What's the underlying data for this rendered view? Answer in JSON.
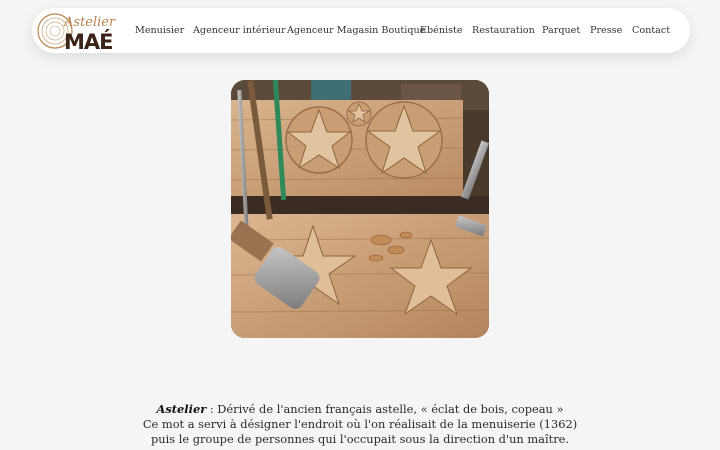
{
  "brand": {
    "script_text": "Astelier",
    "name": "MAÉ",
    "accent_color": "#b8834e",
    "name_color": "#3b2416"
  },
  "nav": {
    "items": [
      {
        "label": "Menuisier"
      },
      {
        "label": "Agenceur intérieur"
      },
      {
        "label": "Agenceur Magasin Boutique"
      },
      {
        "label": "Ebéniste"
      },
      {
        "label": "Restauration"
      },
      {
        "label": "Parquet"
      },
      {
        "label": "Presse"
      },
      {
        "label": "Contact"
      }
    ]
  },
  "hero": {
    "icon": "wood-carving-photo"
  },
  "definition": {
    "term": "Astelier",
    "line1": " : Dérivé de l'ancien français astelle, « éclat de bois, copeau »",
    "line2": "Ce mot a servi à désigner l'endroit où l'on réalisait de la menuiserie (1362)",
    "line3": "puis le groupe de personnes qui l'occupait sous la direction d'un maître."
  }
}
